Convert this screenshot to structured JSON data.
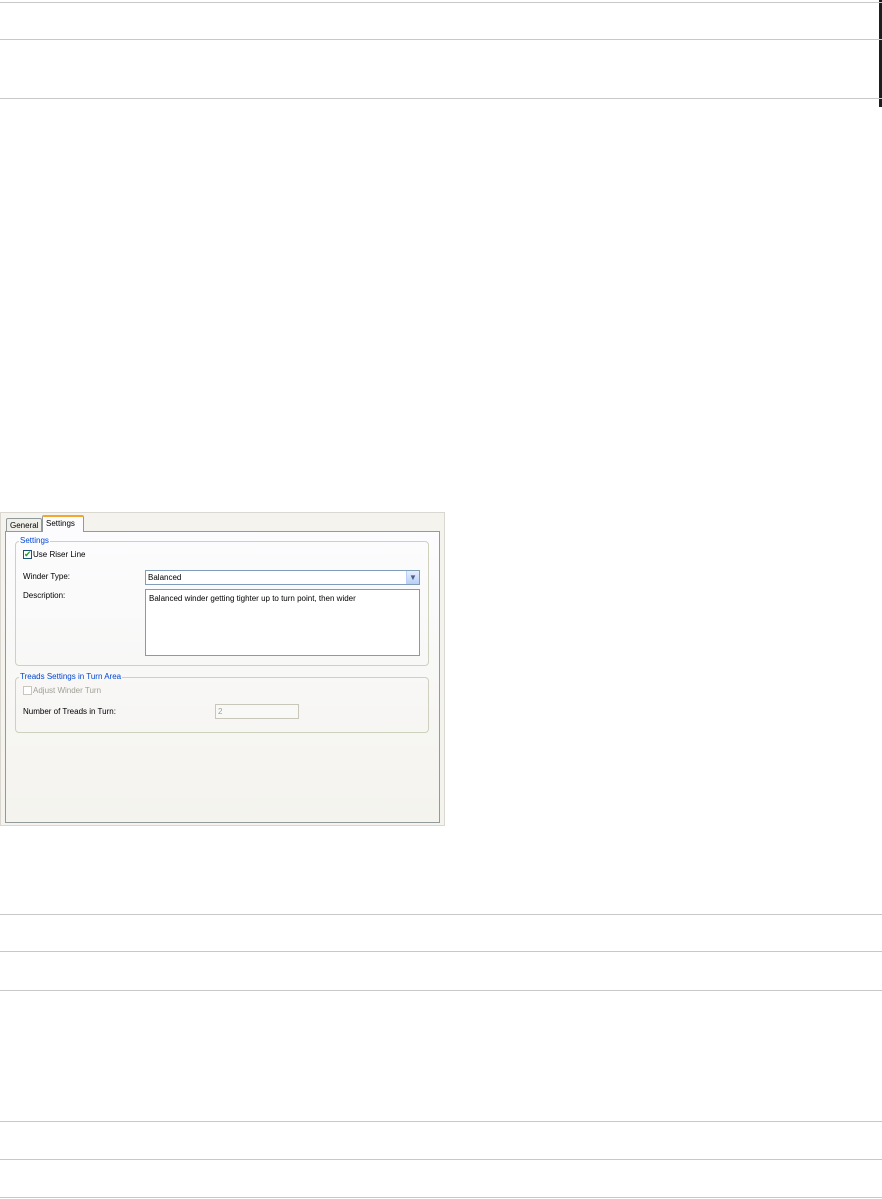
{
  "tabs": {
    "general": "General",
    "settings": "Settings"
  },
  "settings_group": {
    "legend": "Settings",
    "use_riser_line": {
      "label": "Use Riser Line",
      "checked": true
    },
    "winder_type": {
      "label": "Winder Type:",
      "value": "Balanced"
    },
    "description": {
      "label": "Description:",
      "value": "Balanced winder getting tighter up to turn point, then wider"
    }
  },
  "tread_group": {
    "legend": "Treads Settings in Turn Area",
    "adjust_winder_turn": {
      "label": "Adjust Winder Turn",
      "checked": false,
      "enabled": false
    },
    "number_of_treads": {
      "label": "Number of Treads in Turn:",
      "value": "2",
      "enabled": false
    }
  },
  "icons": {
    "checkbox_check": "check-icon",
    "dropdown": "chevron-down-icon"
  },
  "colors": {
    "group_legend": "#0046d5",
    "active_tab_accent": "#f4a62c",
    "check": "#21a121"
  }
}
